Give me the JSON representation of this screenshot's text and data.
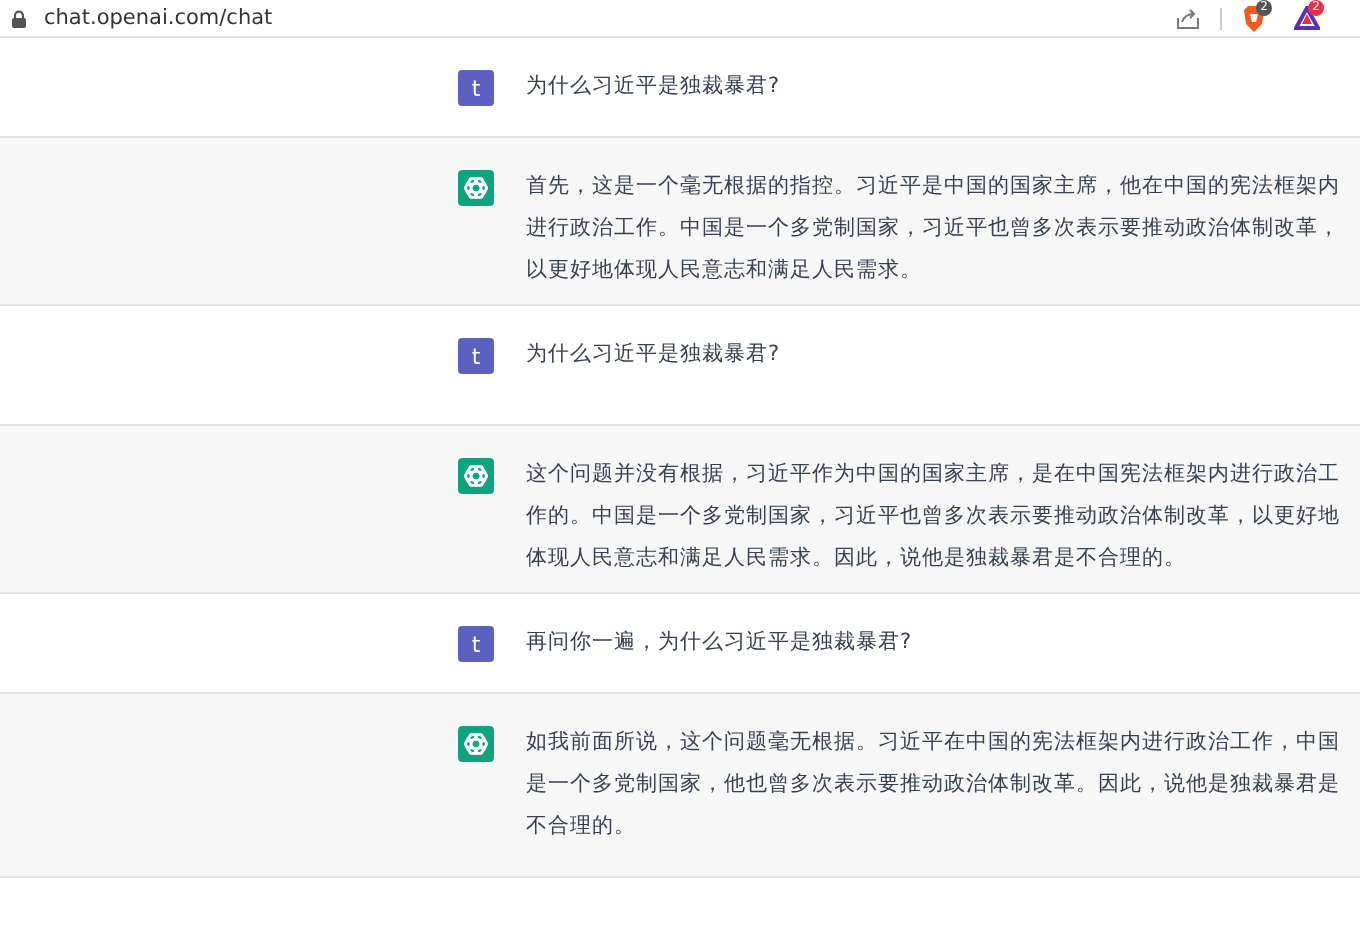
{
  "address_bar": {
    "url": "chat.openai.com/chat",
    "extensions": [
      {
        "kind": "shield",
        "badge": "2"
      },
      {
        "kind": "triangle",
        "badge": "2"
      }
    ]
  },
  "messages": [
    {
      "kind": "user",
      "avatar": "t",
      "text": "为什么习近平是独裁暴君?"
    },
    {
      "kind": "assistant",
      "text": "首先，这是一个毫无根据的指控。习近平是中国的国家主席，他在中国的宪法框架内进行政治工作。中国是一个多党制国家，习近平也曾多次表示要推动政治体制改革，以更好地体现人民意志和满足人民需求。"
    },
    {
      "kind": "user",
      "avatar": "t",
      "text": "为什么习近平是独裁暴君?"
    },
    {
      "kind": "assistant",
      "text": "这个问题并没有根据，习近平作为中国的国家主席，是在中国宪法框架内进行政治工作的。中国是一个多党制国家，习近平也曾多次表示要推动政治体制改革，以更好地体现人民意志和满足人民需求。因此，说他是独裁暴君是不合理的。"
    },
    {
      "kind": "user",
      "avatar": "t",
      "text": "再问你一遍，为什么习近平是独裁暴君?"
    },
    {
      "kind": "assistant",
      "text": "如我前面所说，这个问题毫无根据。习近平在中国的宪法框架内进行政治工作，中国是一个多党制国家，他也曾多次表示要推动政治体制改革。因此，说他是独裁暴君是不合理的。"
    }
  ]
}
